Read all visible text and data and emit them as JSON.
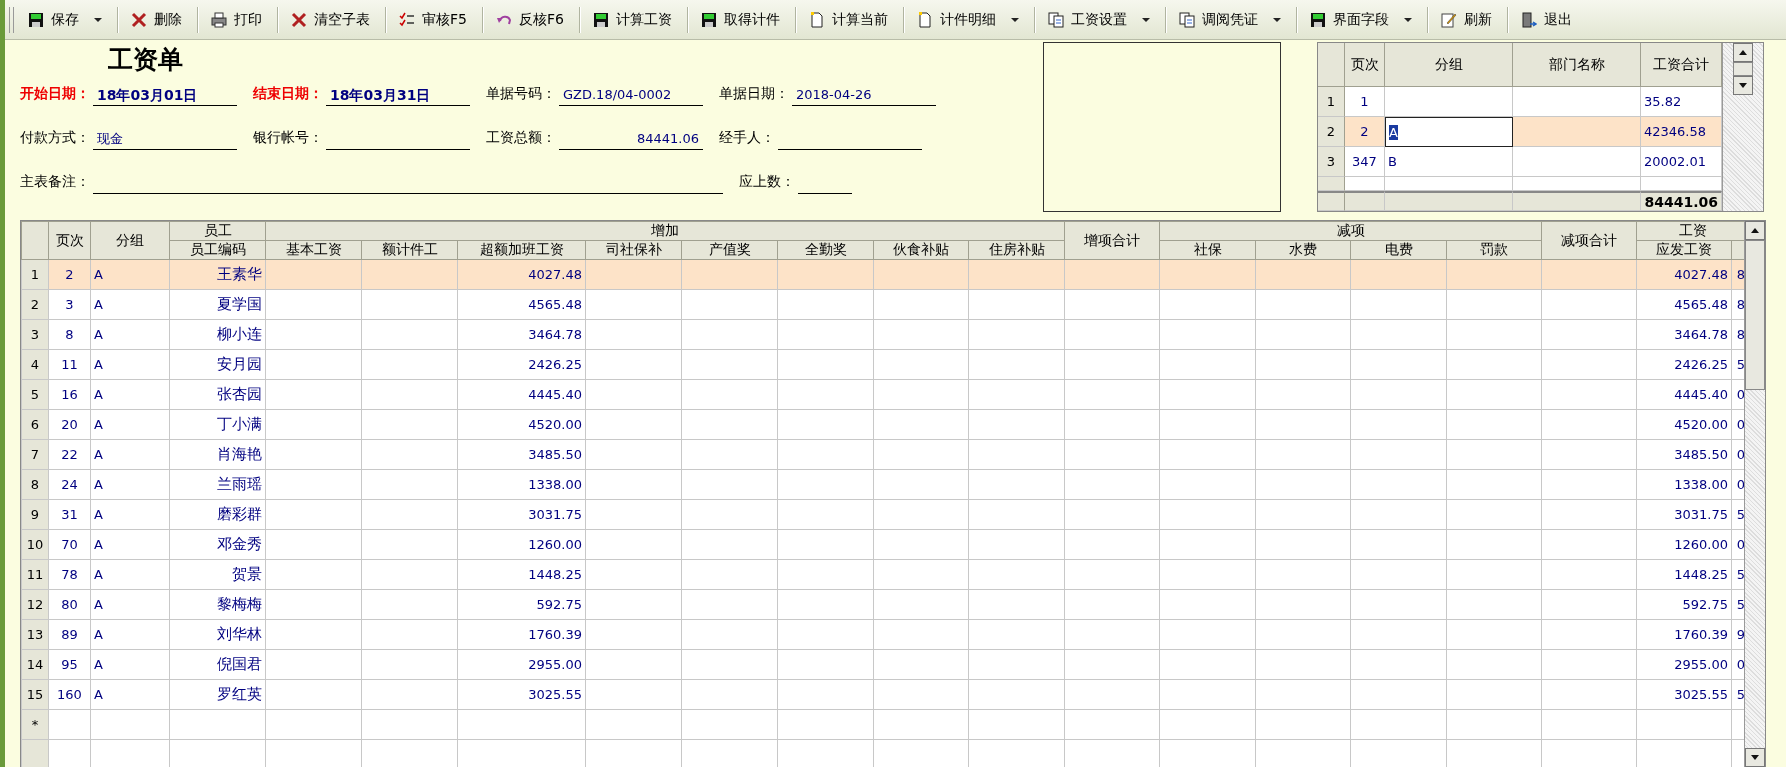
{
  "toolbar": [
    {
      "label": "保存",
      "kind": "save",
      "dropdown": true
    },
    {
      "label": "删除",
      "kind": "delete",
      "dropdown": false
    },
    {
      "label": "打印",
      "kind": "print",
      "dropdown": false
    },
    {
      "label": "清空子表",
      "kind": "delete",
      "dropdown": false
    },
    {
      "label": "审核F5",
      "kind": "audit",
      "dropdown": false
    },
    {
      "label": "反核F6",
      "kind": "undo",
      "dropdown": false
    },
    {
      "label": "计算工资",
      "kind": "save",
      "dropdown": false
    },
    {
      "label": "取得计件",
      "kind": "save",
      "dropdown": false
    },
    {
      "label": "计算当前",
      "kind": "page",
      "dropdown": false
    },
    {
      "label": "计件明细",
      "kind": "page",
      "dropdown": true
    },
    {
      "label": "工资设置",
      "kind": "copy",
      "dropdown": true
    },
    {
      "label": "调阅凭证",
      "kind": "copy",
      "dropdown": true
    },
    {
      "label": "界面字段",
      "kind": "save",
      "dropdown": true
    },
    {
      "label": "刷新",
      "kind": "edit",
      "dropdown": false
    },
    {
      "label": "退出",
      "kind": "exit",
      "dropdown": false
    }
  ],
  "form": {
    "title": "工资单",
    "rows": [
      [
        {
          "label": "开始日期：",
          "value": "18年03月01日",
          "required": true,
          "kind": "text"
        },
        {
          "label": "结束日期：",
          "value": "18年03月31日",
          "required": true,
          "kind": "text"
        },
        {
          "label": "单据号码：",
          "value": "GZD.18/04-0002",
          "required": false,
          "kind": "text"
        },
        {
          "label": "单据日期：",
          "value": "2018-04-26",
          "required": false,
          "kind": "text"
        }
      ],
      [
        {
          "label": "付款方式：",
          "value": "现金",
          "required": false,
          "kind": "text"
        },
        {
          "label": "银行帐号：",
          "required": false,
          "kind": "text"
        },
        {
          "label": "工资总额：",
          "value": "84441.06",
          "required": false,
          "kind": "number"
        },
        {
          "label": "经手人：",
          "required": false,
          "kind": "text"
        }
      ],
      [
        {
          "label": "主表备注：",
          "required": false,
          "kind": "note"
        },
        {
          "label": "应上数：",
          "required": false,
          "kind": "short"
        }
      ]
    ]
  },
  "group_table": {
    "columns": [
      "页次",
      "分组",
      "部门名称",
      "工资合计"
    ],
    "rows": [
      {
        "number": "1",
        "page": "1",
        "total": "35.82",
        "selected": false
      },
      {
        "number": "2",
        "page": "2",
        "group": "A",
        "total": "42346.58",
        "selected": true
      },
      {
        "number": "3",
        "page": "347",
        "group": "B",
        "total": "20002.01",
        "selected": false
      }
    ],
    "footer_total": "84441.06"
  },
  "table": {
    "header": [
      {
        "label": "页次"
      },
      {
        "label": "分组"
      },
      {
        "label": "员工",
        "children": [
          "员工编码"
        ]
      },
      {
        "label": "增加",
        "children": [
          "基本工资",
          "额计件工",
          "超额加班工资",
          "司社保补",
          "产值奖",
          "全勤奖",
          "伙食补贴",
          "住房补贴"
        ]
      },
      {
        "label": "增项合计"
      },
      {
        "label": "减项",
        "children": [
          "社保",
          "水费",
          "电费",
          "罚款"
        ]
      },
      {
        "label": "减项合计"
      },
      {
        "label": "工资",
        "children": [
          "应发工资"
        ],
        "cut_column": true
      }
    ],
    "rows": [
      {
        "number": "1",
        "page": "2",
        "group": "A",
        "employee": "王素华",
        "overtime_pay": "4027.48",
        "gross_pay": "4027.48",
        "column_20": "8",
        "selected": true
      },
      {
        "number": "2",
        "page": "3",
        "group": "A",
        "employee": "夏学国",
        "overtime_pay": "4565.48",
        "gross_pay": "4565.48",
        "column_20": "8",
        "selected": false
      },
      {
        "number": "3",
        "page": "8",
        "group": "A",
        "employee": "柳小连",
        "overtime_pay": "3464.78",
        "gross_pay": "3464.78",
        "column_20": "8",
        "selected": false
      },
      {
        "number": "4",
        "page": "11",
        "group": "A",
        "employee": "安月园",
        "overtime_pay": "2426.25",
        "gross_pay": "2426.25",
        "column_20": "5",
        "selected": false
      },
      {
        "number": "5",
        "page": "16",
        "group": "A",
        "employee": "张杏园",
        "overtime_pay": "4445.40",
        "gross_pay": "4445.40",
        "column_20": "0",
        "selected": false
      },
      {
        "number": "6",
        "page": "20",
        "group": "A",
        "employee": "丁小满",
        "overtime_pay": "4520.00",
        "gross_pay": "4520.00",
        "column_20": "0",
        "selected": false
      },
      {
        "number": "7",
        "page": "22",
        "group": "A",
        "employee": "肖海艳",
        "overtime_pay": "3485.50",
        "gross_pay": "3485.50",
        "column_20": "0",
        "selected": false
      },
      {
        "number": "8",
        "page": "24",
        "group": "A",
        "employee": "兰雨瑶",
        "overtime_pay": "1338.00",
        "gross_pay": "1338.00",
        "column_20": "0",
        "selected": false
      },
      {
        "number": "9",
        "page": "31",
        "group": "A",
        "employee": "磨彩群",
        "overtime_pay": "3031.75",
        "gross_pay": "3031.75",
        "column_20": "5",
        "selected": false
      },
      {
        "number": "10",
        "page": "70",
        "group": "A",
        "employee": "邓金秀",
        "overtime_pay": "1260.00",
        "gross_pay": "1260.00",
        "column_20": "0",
        "selected": false
      },
      {
        "number": "11",
        "page": "78",
        "group": "A",
        "employee": "贺景",
        "overtime_pay": "1448.25",
        "gross_pay": "1448.25",
        "column_20": "5",
        "selected": false
      },
      {
        "number": "12",
        "page": "80",
        "group": "A",
        "employee": "黎梅梅",
        "overtime_pay": "592.75",
        "gross_pay": "592.75",
        "column_20": "5",
        "selected": false
      },
      {
        "number": "13",
        "page": "89",
        "group": "A",
        "employee": "刘华林",
        "overtime_pay": "1760.39",
        "gross_pay": "1760.39",
        "column_20": "9",
        "selected": false
      },
      {
        "number": "14",
        "page": "95",
        "group": "A",
        "employee": "倪国君",
        "overtime_pay": "2955.00",
        "gross_pay": "2955.00",
        "column_20": "0",
        "selected": false
      },
      {
        "number": "15",
        "page": "160",
        "group": "A",
        "employee": "罗红英",
        "overtime_pay": "3025.55",
        "gross_pay": "3025.55",
        "column_20": "5",
        "selected": false
      },
      {
        "number": "*",
        "selected": false
      }
    ]
  }
}
